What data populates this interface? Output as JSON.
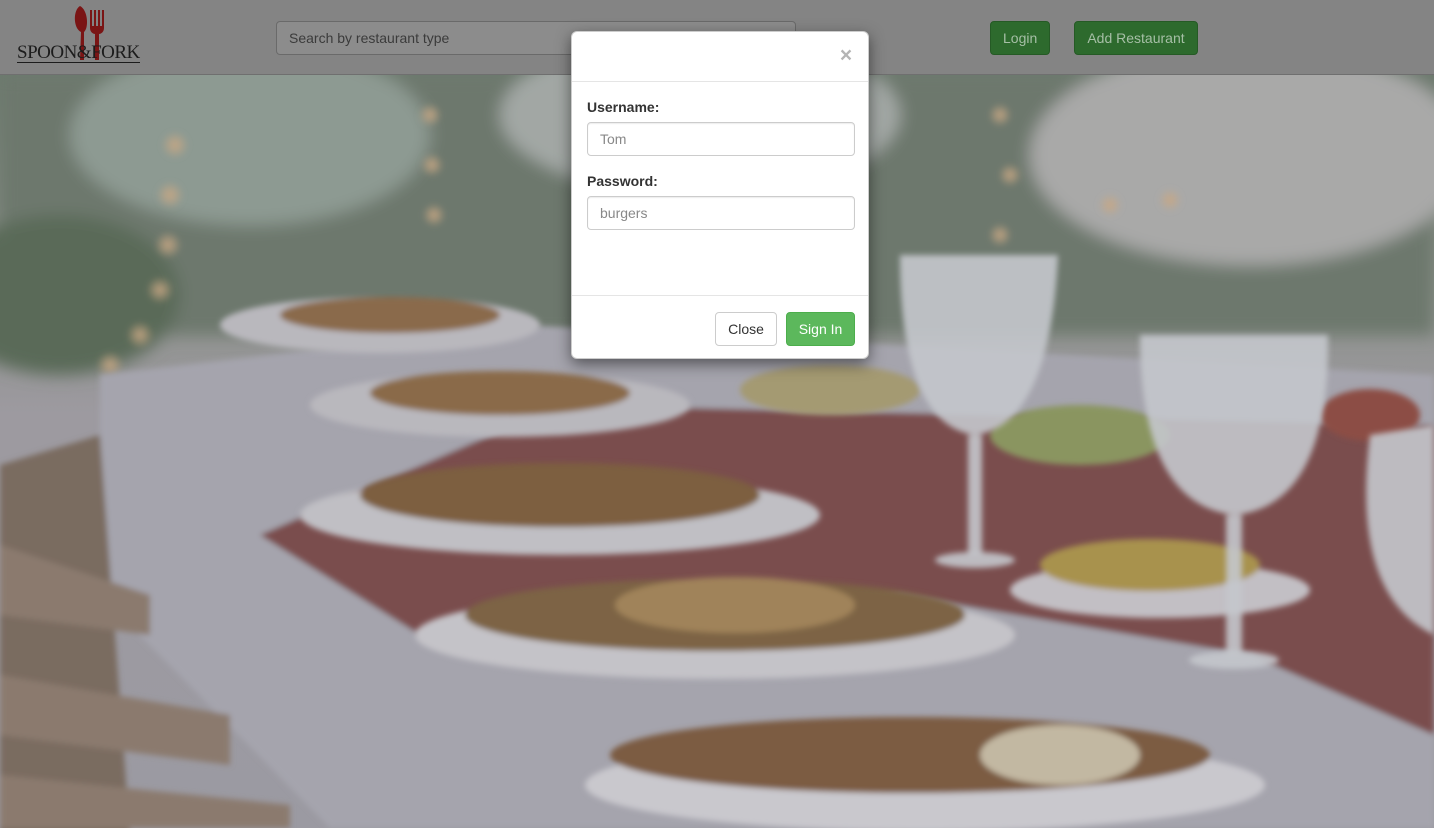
{
  "navbar": {
    "logo_text": "SPOON&FORK",
    "search_placeholder": "Search by restaurant type",
    "login_label": "Login",
    "add_restaurant_label": "Add Restaurant"
  },
  "modal": {
    "close_symbol": "×",
    "username_label": "Username:",
    "username_placeholder": "Tom",
    "password_label": "Password:",
    "password_placeholder": "burgers",
    "close_button_label": "Close",
    "signin_button_label": "Sign In"
  },
  "colors": {
    "primary_green": "#5cb85c",
    "logo_red": "#9b1b1b"
  },
  "icons": {
    "logo": "spoon-fork-icon",
    "modal_close": "close-icon"
  }
}
